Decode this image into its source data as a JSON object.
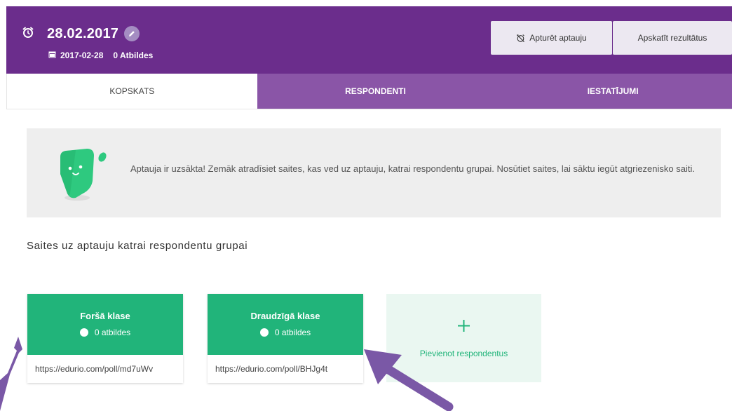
{
  "header": {
    "title": "28.02.2017",
    "date": "2017-02-28",
    "answers": "0 Atbildes",
    "stop_button": "Apturēt aptauju",
    "results_button": "Apskatīt rezultātus",
    "background_color": "#6b2d8c",
    "icons": [
      "alarm-clock-icon",
      "pencil-icon",
      "calendar-icon",
      "alarm-off-icon"
    ]
  },
  "tabs": [
    {
      "label": "KOPSKATS",
      "active": true
    },
    {
      "label": "RESPONDENTI",
      "active": false
    },
    {
      "label": "IESTATĪJUMI",
      "active": false
    }
  ],
  "notice": {
    "text": "Aptauja ir uzsākta! Zemāk atradīsiet saites, kas ved uz aptauju, katrai respondentu grupai. Nosūtiet saites, lai sāktu iegūt atgriezenisko saiti.",
    "icon": "mascot-icon"
  },
  "section": {
    "title": "Saites uz aptauju katrai respondentu grupai"
  },
  "groups": [
    {
      "name": "Foršā klase",
      "count": "0 atbildes",
      "link": "https://edurio.com/poll/md7uWv"
    },
    {
      "name": "Draudzīgā klase",
      "count": "0 atbildes",
      "link": "https://edurio.com/poll/BHJg4t"
    }
  ],
  "add_group": {
    "label": "Pievienot respondentus",
    "icon": "plus-icon"
  },
  "colors": {
    "accent_green": "#21b47a",
    "tab_purple": "#8a55a7",
    "annotation_arrow": "#7a58a6"
  }
}
